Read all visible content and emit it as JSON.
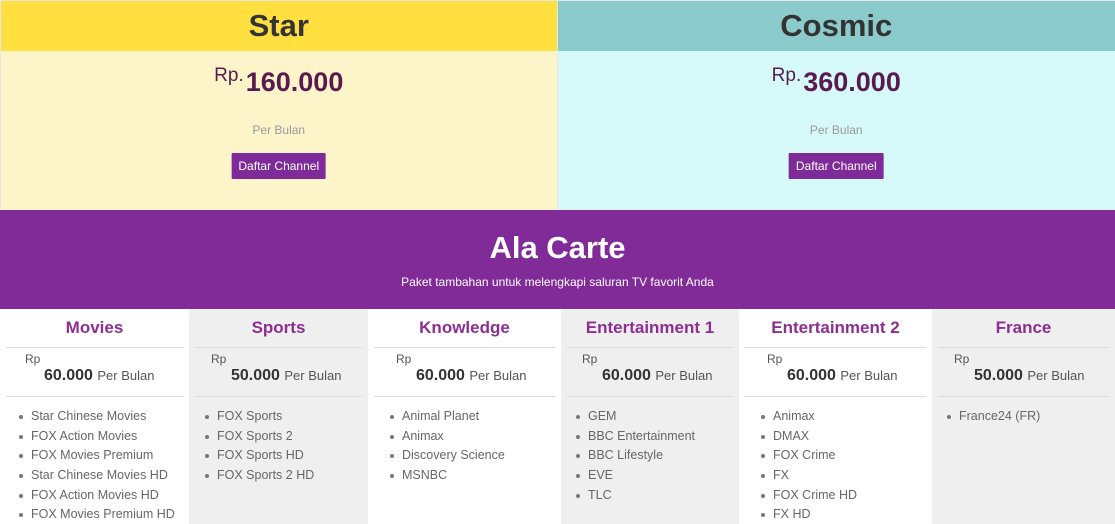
{
  "plans": [
    {
      "name": "Star",
      "currency": "Rp.",
      "price": "160.000",
      "period": "Per Bulan",
      "button": "Daftar Channel",
      "header_color": "#ffe040",
      "body_color": "#fdf5c9"
    },
    {
      "name": "Cosmic",
      "currency": "Rp.",
      "price": "360.000",
      "period": "Per Bulan",
      "button": "Daftar Channel",
      "header_color": "#8ccbcb",
      "body_color": "#d6f9fa"
    }
  ],
  "banner": {
    "title": "Ala Carte",
    "subtitle": "Paket tambahan untuk melengkapi saluran TV favorit Anda",
    "color": "#812b99"
  },
  "packages": [
    {
      "title": "Movies",
      "currency": "Rp",
      "price": "60.000",
      "period": "Per Bulan",
      "channels": [
        "Star Chinese Movies",
        "FOX Action Movies",
        "FOX Movies Premium",
        "Star Chinese Movies HD",
        "FOX Action Movies HD",
        "FOX Movies Premium HD"
      ]
    },
    {
      "title": "Sports",
      "currency": "Rp",
      "price": "50.000",
      "period": "Per Bulan",
      "channels": [
        "FOX Sports",
        "FOX Sports 2",
        "FOX Sports HD",
        "FOX Sports 2 HD"
      ]
    },
    {
      "title": "Knowledge",
      "currency": "Rp",
      "price": "60.000",
      "period": "Per Bulan",
      "channels": [
        "Animal Planet",
        "Animax",
        "Discovery Science",
        "MSNBC"
      ]
    },
    {
      "title": "Entertainment 1",
      "currency": "Rp",
      "price": "60.000",
      "period": "Per Bulan",
      "channels": [
        "GEM",
        "BBC Entertainment",
        "BBC Lifestyle",
        "EVE",
        "TLC"
      ]
    },
    {
      "title": "Entertainment 2",
      "currency": "Rp",
      "price": "60.000",
      "period": "Per Bulan",
      "channels": [
        "Animax",
        "DMAX",
        "FOX Crime",
        "FX",
        "FOX Crime HD",
        "FX HD"
      ]
    },
    {
      "title": "France",
      "currency": "Rp",
      "price": "50.000",
      "period": "Per Bulan",
      "channels": [
        "France24 (FR)"
      ]
    }
  ]
}
